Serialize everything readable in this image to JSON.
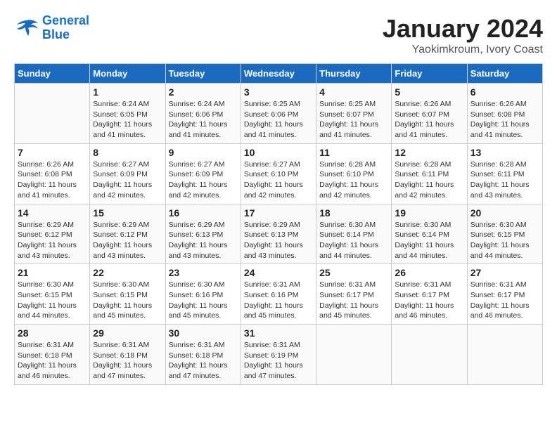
{
  "logo": {
    "line1": "General",
    "line2": "Blue"
  },
  "title": "January 2024",
  "subtitle": "Yaokimkroum, Ivory Coast",
  "days_of_week": [
    "Sunday",
    "Monday",
    "Tuesday",
    "Wednesday",
    "Thursday",
    "Friday",
    "Saturday"
  ],
  "weeks": [
    [
      {
        "day": "",
        "info": ""
      },
      {
        "day": "1",
        "info": "Sunrise: 6:24 AM\nSunset: 6:05 PM\nDaylight: 11 hours\nand 41 minutes."
      },
      {
        "day": "2",
        "info": "Sunrise: 6:24 AM\nSunset: 6:06 PM\nDaylight: 11 hours\nand 41 minutes."
      },
      {
        "day": "3",
        "info": "Sunrise: 6:25 AM\nSunset: 6:06 PM\nDaylight: 11 hours\nand 41 minutes."
      },
      {
        "day": "4",
        "info": "Sunrise: 6:25 AM\nSunset: 6:07 PM\nDaylight: 11 hours\nand 41 minutes."
      },
      {
        "day": "5",
        "info": "Sunrise: 6:26 AM\nSunset: 6:07 PM\nDaylight: 11 hours\nand 41 minutes."
      },
      {
        "day": "6",
        "info": "Sunrise: 6:26 AM\nSunset: 6:08 PM\nDaylight: 11 hours\nand 41 minutes."
      }
    ],
    [
      {
        "day": "7",
        "info": "Sunrise: 6:26 AM\nSunset: 6:08 PM\nDaylight: 11 hours\nand 41 minutes."
      },
      {
        "day": "8",
        "info": "Sunrise: 6:27 AM\nSunset: 6:09 PM\nDaylight: 11 hours\nand 42 minutes."
      },
      {
        "day": "9",
        "info": "Sunrise: 6:27 AM\nSunset: 6:09 PM\nDaylight: 11 hours\nand 42 minutes."
      },
      {
        "day": "10",
        "info": "Sunrise: 6:27 AM\nSunset: 6:10 PM\nDaylight: 11 hours\nand 42 minutes."
      },
      {
        "day": "11",
        "info": "Sunrise: 6:28 AM\nSunset: 6:10 PM\nDaylight: 11 hours\nand 42 minutes."
      },
      {
        "day": "12",
        "info": "Sunrise: 6:28 AM\nSunset: 6:11 PM\nDaylight: 11 hours\nand 42 minutes."
      },
      {
        "day": "13",
        "info": "Sunrise: 6:28 AM\nSunset: 6:11 PM\nDaylight: 11 hours\nand 43 minutes."
      }
    ],
    [
      {
        "day": "14",
        "info": "Sunrise: 6:29 AM\nSunset: 6:12 PM\nDaylight: 11 hours\nand 43 minutes."
      },
      {
        "day": "15",
        "info": "Sunrise: 6:29 AM\nSunset: 6:12 PM\nDaylight: 11 hours\nand 43 minutes."
      },
      {
        "day": "16",
        "info": "Sunrise: 6:29 AM\nSunset: 6:13 PM\nDaylight: 11 hours\nand 43 minutes."
      },
      {
        "day": "17",
        "info": "Sunrise: 6:29 AM\nSunset: 6:13 PM\nDaylight: 11 hours\nand 43 minutes."
      },
      {
        "day": "18",
        "info": "Sunrise: 6:30 AM\nSunset: 6:14 PM\nDaylight: 11 hours\nand 44 minutes."
      },
      {
        "day": "19",
        "info": "Sunrise: 6:30 AM\nSunset: 6:14 PM\nDaylight: 11 hours\nand 44 minutes."
      },
      {
        "day": "20",
        "info": "Sunrise: 6:30 AM\nSunset: 6:15 PM\nDaylight: 11 hours\nand 44 minutes."
      }
    ],
    [
      {
        "day": "21",
        "info": "Sunrise: 6:30 AM\nSunset: 6:15 PM\nDaylight: 11 hours\nand 44 minutes."
      },
      {
        "day": "22",
        "info": "Sunrise: 6:30 AM\nSunset: 6:15 PM\nDaylight: 11 hours\nand 45 minutes."
      },
      {
        "day": "23",
        "info": "Sunrise: 6:30 AM\nSunset: 6:16 PM\nDaylight: 11 hours\nand 45 minutes."
      },
      {
        "day": "24",
        "info": "Sunrise: 6:31 AM\nSunset: 6:16 PM\nDaylight: 11 hours\nand 45 minutes."
      },
      {
        "day": "25",
        "info": "Sunrise: 6:31 AM\nSunset: 6:17 PM\nDaylight: 11 hours\nand 45 minutes."
      },
      {
        "day": "26",
        "info": "Sunrise: 6:31 AM\nSunset: 6:17 PM\nDaylight: 11 hours\nand 46 minutes."
      },
      {
        "day": "27",
        "info": "Sunrise: 6:31 AM\nSunset: 6:17 PM\nDaylight: 11 hours\nand 46 minutes."
      }
    ],
    [
      {
        "day": "28",
        "info": "Sunrise: 6:31 AM\nSunset: 6:18 PM\nDaylight: 11 hours\nand 46 minutes."
      },
      {
        "day": "29",
        "info": "Sunrise: 6:31 AM\nSunset: 6:18 PM\nDaylight: 11 hours\nand 47 minutes."
      },
      {
        "day": "30",
        "info": "Sunrise: 6:31 AM\nSunset: 6:18 PM\nDaylight: 11 hours\nand 47 minutes."
      },
      {
        "day": "31",
        "info": "Sunrise: 6:31 AM\nSunset: 6:19 PM\nDaylight: 11 hours\nand 47 minutes."
      },
      {
        "day": "",
        "info": ""
      },
      {
        "day": "",
        "info": ""
      },
      {
        "day": "",
        "info": ""
      }
    ]
  ]
}
